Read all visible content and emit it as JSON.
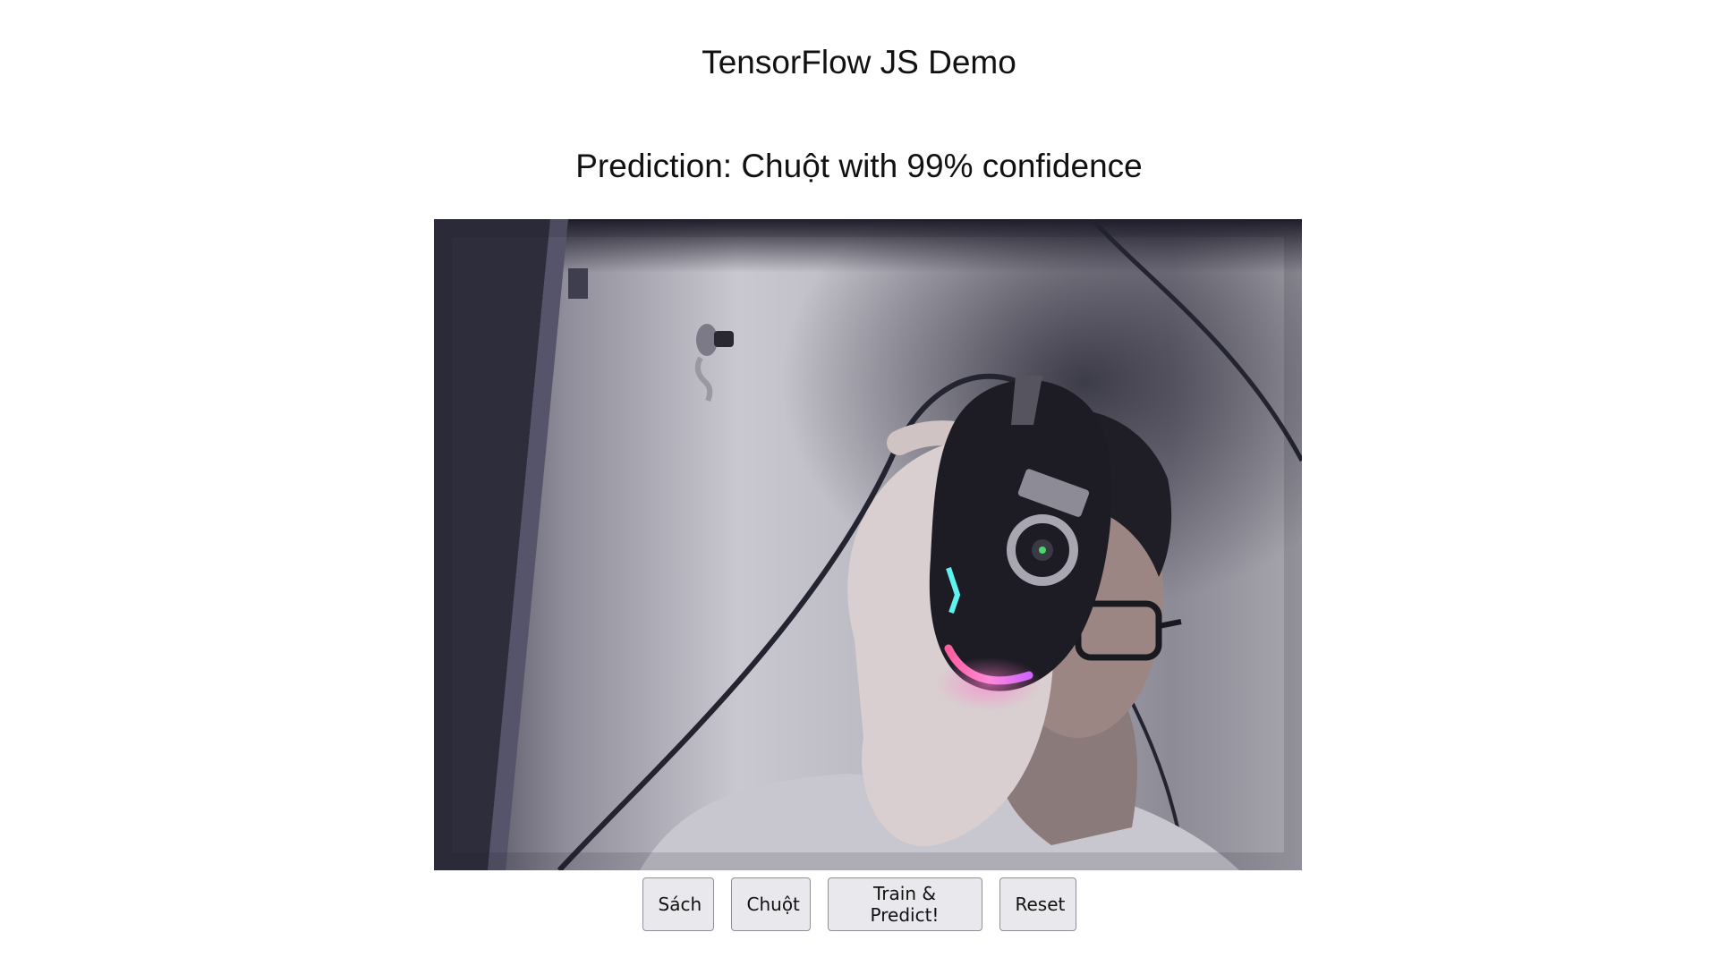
{
  "page": {
    "title": "TensorFlow JS Demo",
    "prediction": "Prediction: Chuột with 99% confidence"
  },
  "video": {
    "description_icon": "webcam-feed"
  },
  "buttons": {
    "class_1": "Sách",
    "class_2": "Chuột",
    "train": "Train & Predict!",
    "reset": "Reset"
  },
  "colors": {
    "background": "#ffffff",
    "button_bg": "#e9e9ed",
    "button_border": "#8f8f9d",
    "text": "#111111"
  }
}
